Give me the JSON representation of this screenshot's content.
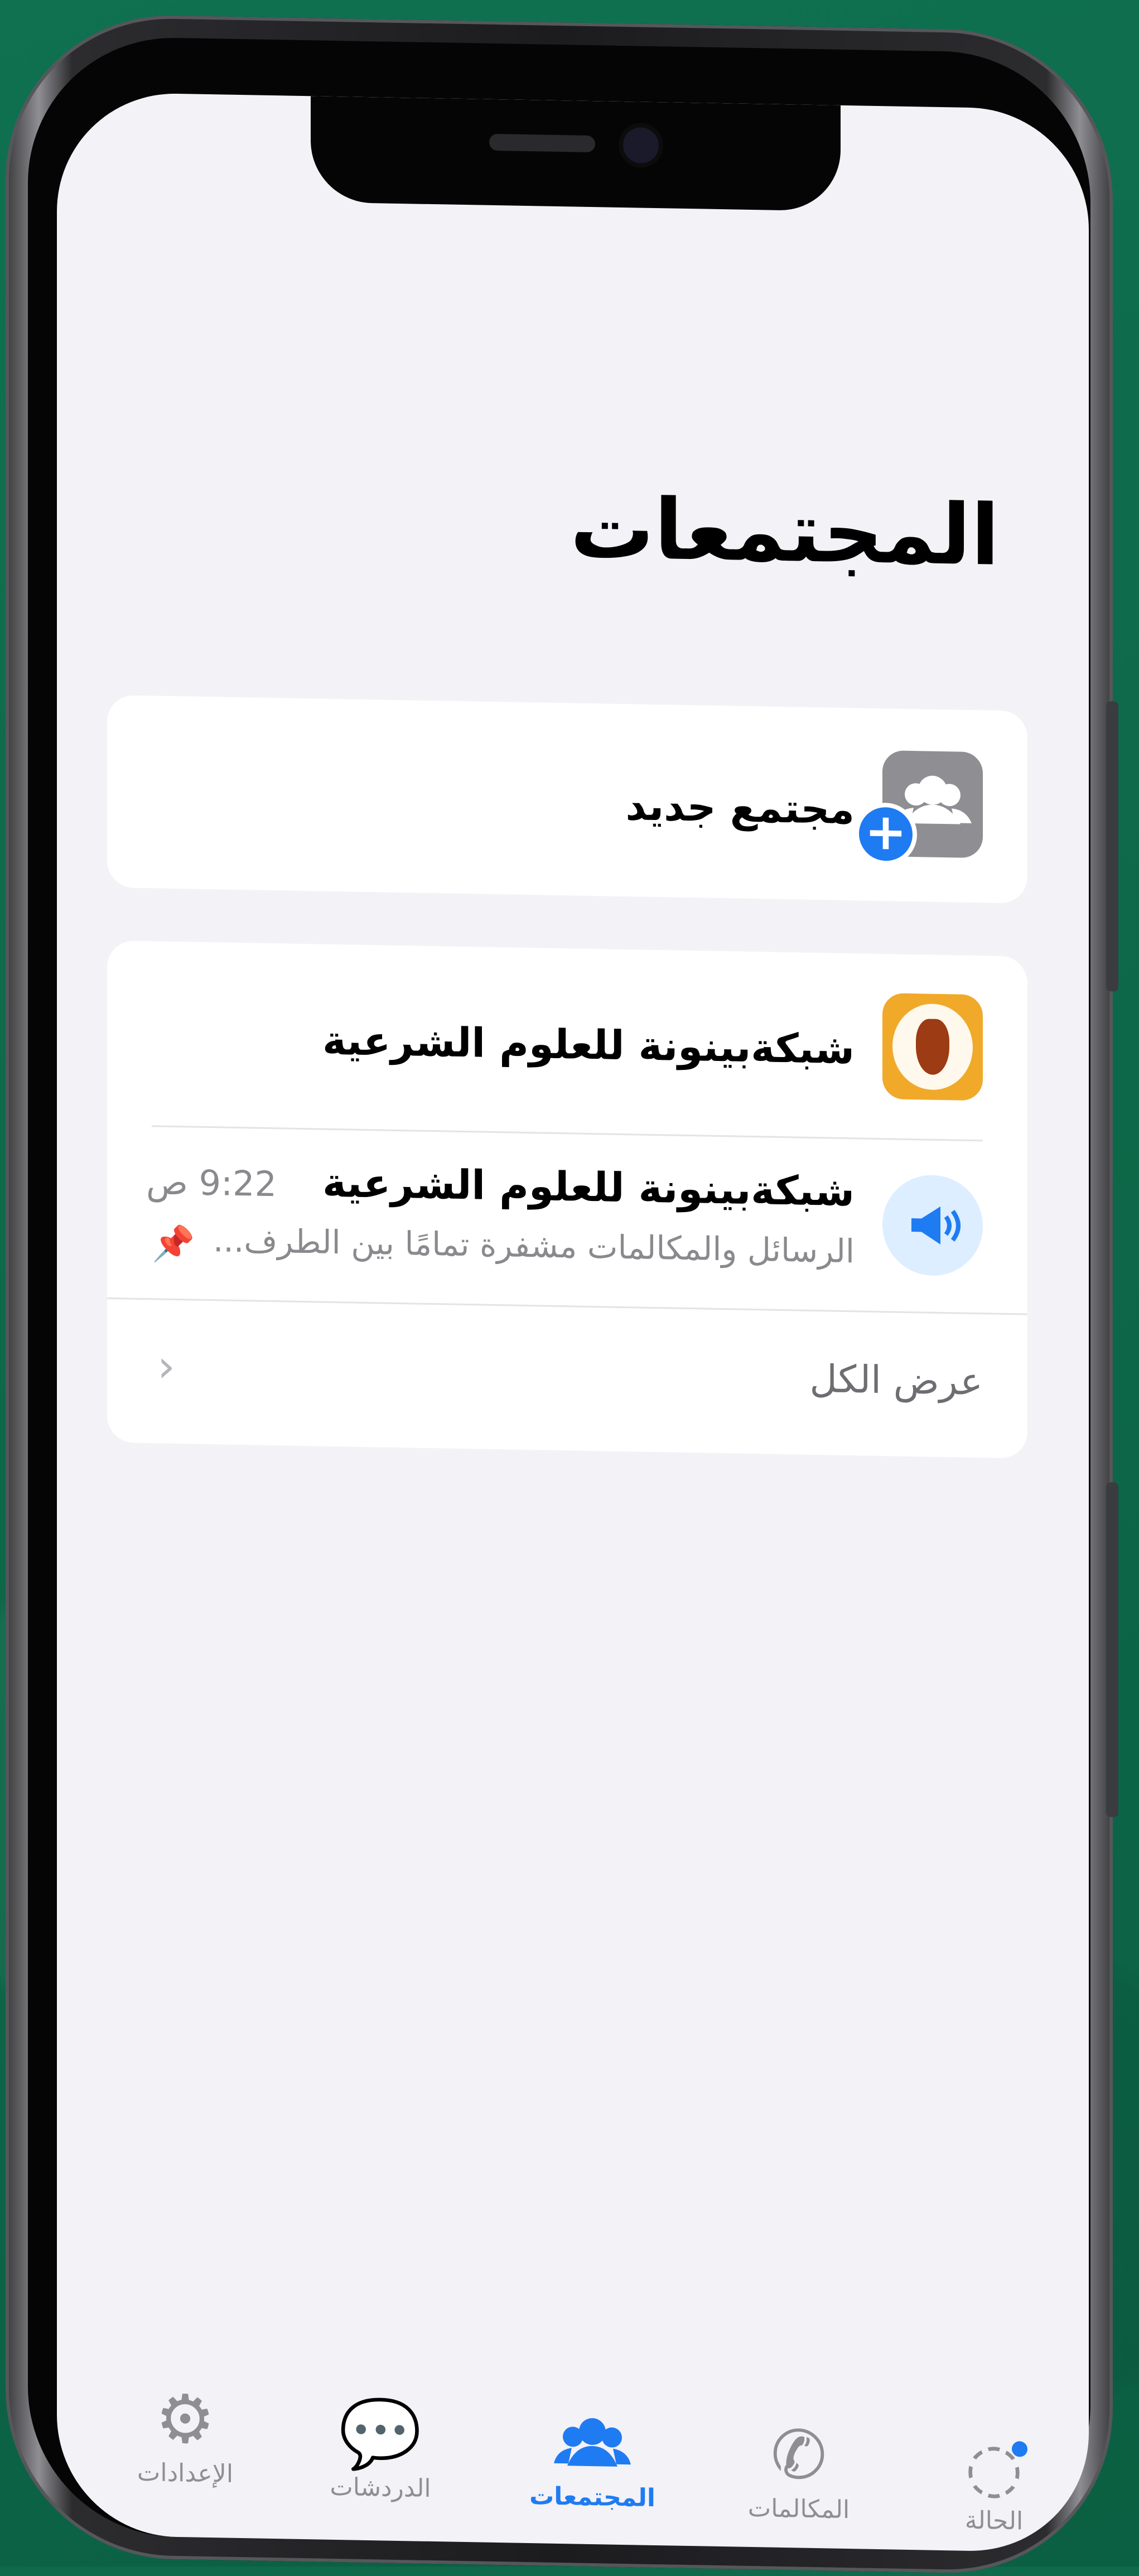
{
  "header": {
    "title": "المجتمعات"
  },
  "new_community": {
    "label": "مجتمع جديد"
  },
  "community": {
    "name": "شبكةبينونة للعلوم الشرعية",
    "announcement": {
      "title": "شبكةبينونة للعلوم الشرعية",
      "time": "9:22 ص",
      "preview": "الرسائل والمكالمات مشفرة تمامًا بين الطرف..."
    },
    "view_all_label": "عرض الكل"
  },
  "tabbar": {
    "items": [
      {
        "label": "الحالة",
        "icon": "status-icon"
      },
      {
        "label": "المكالمات",
        "icon": "phone-icon"
      },
      {
        "label": "المجتمعات",
        "icon": "communities-icon",
        "active": true
      },
      {
        "label": "الدردشات",
        "icon": "chats-icon"
      },
      {
        "label": "الإعدادات",
        "icon": "settings-icon"
      }
    ]
  },
  "colors": {
    "accent": "#1f7bf2",
    "background": "#f3f2f7",
    "card": "#ffffff",
    "wallpaper": "#0e6a4a"
  }
}
